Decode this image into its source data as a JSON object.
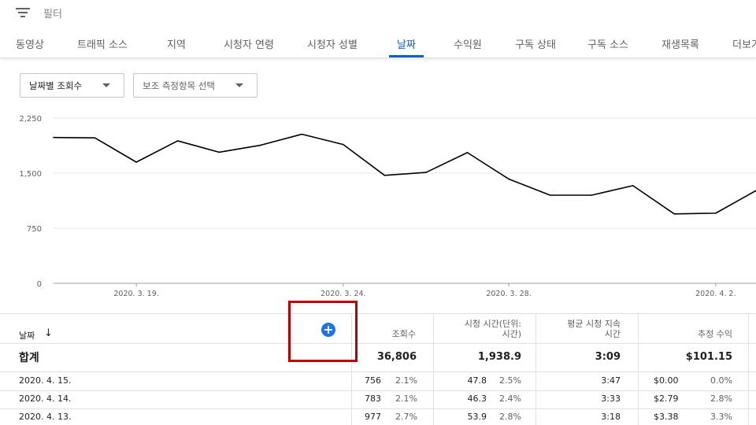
{
  "filter": {
    "label": "필터",
    "icon": "filter-list-icon"
  },
  "tabs": [
    {
      "label": "동영상",
      "active": false
    },
    {
      "label": "트래픽 소스",
      "active": false
    },
    {
      "label": "지역",
      "active": false
    },
    {
      "label": "시청자 연령",
      "active": false
    },
    {
      "label": "시청자 성별",
      "active": false
    },
    {
      "label": "날짜",
      "active": true
    },
    {
      "label": "수익원",
      "active": false
    },
    {
      "label": "구독 상태",
      "active": false
    },
    {
      "label": "구독 소스",
      "active": false
    },
    {
      "label": "재생목록",
      "active": false
    },
    {
      "label": "더보기",
      "active": false
    }
  ],
  "dropdowns": {
    "metric": "날짜별 조회수",
    "secondary": "보조 측정항목 선택"
  },
  "chart_data": {
    "type": "line",
    "x": [
      "2020. 3. 17.",
      "2020. 3. 18.",
      "2020. 3. 19.",
      "2020. 3. 20.",
      "2020. 3. 21.",
      "2020. 3. 22.",
      "2020. 3. 23.",
      "2020. 3. 24.",
      "2020. 3. 25.",
      "2020. 3. 26.",
      "2020. 3. 27.",
      "2020. 3. 28.",
      "2020. 3. 29.",
      "2020. 3. 30.",
      "2020. 3. 31.",
      "2020. 4. 1.",
      "2020. 4. 2.",
      "2020. 4. 3.",
      "2020. 4. 4."
    ],
    "series": [
      {
        "values": [
          1985,
          1980,
          1650,
          1940,
          1785,
          1880,
          2030,
          1890,
          1470,
          1510,
          1780,
          1420,
          1200,
          1200,
          1330,
          945,
          955,
          1270
        ]
      }
    ],
    "x_tick_labels": [
      "2020. 3. 19.",
      "2020. 3. 24.",
      "2020. 3. 28.",
      "2020. 4. 2."
    ],
    "y_ticks": [
      "2,250",
      "1,500",
      "750",
      "0"
    ],
    "ylim": [
      0,
      2250
    ],
    "grid": true,
    "color": "#000000"
  },
  "table": {
    "sort_column": "날짜",
    "sort_icon": "arrow-down-icon",
    "add_icon": "add-circle-icon",
    "columns": [
      {
        "label": "조회수",
        "label2": ""
      },
      {
        "label": "시청 시간(단위:",
        "label2": "시간)"
      },
      {
        "label": "평균 시청 지속",
        "label2": "시간"
      },
      {
        "label": "추정 수익",
        "label2": ""
      }
    ],
    "total": {
      "label": "합계",
      "views": "36,806",
      "watch_time": "1,938.9",
      "avg_duration": "3:09",
      "revenue": "$101.15"
    },
    "rows": [
      {
        "date": "2020. 4. 15.",
        "views": "756",
        "views_pct": "2.1%",
        "watch": "47.8",
        "watch_pct": "2.5%",
        "avg": "3:47",
        "rev": "$0.00",
        "rev_pct": "0.0%"
      },
      {
        "date": "2020. 4. 14.",
        "views": "783",
        "views_pct": "2.1%",
        "watch": "46.3",
        "watch_pct": "2.4%",
        "avg": "3:33",
        "rev": "$2.79",
        "rev_pct": "2.8%"
      },
      {
        "date": "2020. 4. 13.",
        "views": "977",
        "views_pct": "2.7%",
        "watch": "53.9",
        "watch_pct": "2.8%",
        "avg": "3:18",
        "rev": "$3.38",
        "rev_pct": "3.3%"
      }
    ]
  },
  "colors": {
    "accent": "#065fd4",
    "highlight": "#c00000",
    "add_button": "#1a73e8"
  }
}
